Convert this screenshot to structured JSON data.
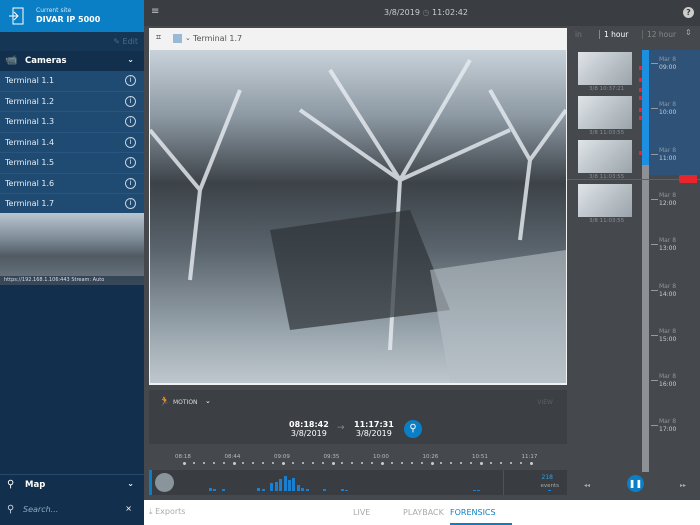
{
  "site": {
    "label": "Current site",
    "name": "DIVAR IP 5000",
    "edit": "Edit"
  },
  "cameras": {
    "title": "Cameras",
    "items": [
      "Terminal 1.1",
      "Terminal 1.2",
      "Terminal 1.3",
      "Terminal 1.4",
      "Terminal 1.5",
      "Terminal 1.6",
      "Terminal 1.7"
    ],
    "info_glyph": "i",
    "stream": "https://192.168.1.106:443 Stream: Auto"
  },
  "map": {
    "title": "Map"
  },
  "search": {
    "placeholder": "Search..."
  },
  "topbar": {
    "date": "3/8/2019",
    "time": "11:02:42"
  },
  "video": {
    "camera": "Terminal 1.7"
  },
  "motion": {
    "label": "MOTION",
    "view": "VIEW",
    "start_time": "08:18:42",
    "start_date": "3/8/2019",
    "end_time": "11:17:31",
    "end_date": "3/8/2019",
    "arrow": "→"
  },
  "timeline": {
    "ticks": [
      "08:18",
      "08:44",
      "09:09",
      "09:35",
      "10:00",
      "10:26",
      "10:51",
      "11:17"
    ],
    "events_count": "218",
    "events_label": "events",
    "bars": [
      0,
      0,
      3,
      2,
      0,
      2,
      0,
      0,
      0,
      0,
      0,
      0,
      0,
      3,
      2,
      0,
      8,
      9,
      12,
      15,
      11,
      13,
      6,
      3,
      2,
      0,
      0,
      0,
      2,
      0,
      0,
      0,
      2,
      1,
      0,
      0,
      0,
      0,
      0,
      0,
      0,
      0,
      0,
      0,
      0,
      0,
      0,
      0,
      0,
      0,
      0,
      0,
      0,
      0,
      0,
      0,
      0,
      0,
      0,
      0,
      0,
      0,
      1,
      1,
      0,
      0,
      0,
      0,
      0,
      0,
      0,
      0,
      0,
      0,
      0,
      0,
      0,
      0,
      0,
      1
    ]
  },
  "tabs": {
    "exports": "Exports",
    "live": "LIVE",
    "playback": "PLAYBACK",
    "forensics": "FORENSICS"
  },
  "right": {
    "zoom_options": [
      "in",
      "1 hour",
      "12 hour"
    ],
    "thumbs": [
      {
        "ts": "3/8 10:37:21"
      },
      {
        "ts": "3/8 11:03:55"
      },
      {
        "ts": "3/8 11:03:55"
      },
      {
        "ts": "3/8 11:03:55"
      }
    ],
    "times": [
      {
        "d": "Mar 8",
        "t": "09:00"
      },
      {
        "d": "Mar 8",
        "t": "10:00"
      },
      {
        "d": "Mar 8",
        "t": "11:00"
      },
      {
        "d": "Mar 8",
        "t": "12:00"
      },
      {
        "d": "Mar 8",
        "t": "13:00"
      },
      {
        "d": "Mar 8",
        "t": "14:00"
      },
      {
        "d": "Mar 8",
        "t": "15:00"
      },
      {
        "d": "Mar 8",
        "t": "16:00"
      },
      {
        "d": "Mar 8",
        "t": "17:00"
      }
    ]
  },
  "colors": {
    "accent": "#0b7fc6",
    "sidebar": "#12304e",
    "marker": "#e8242c"
  }
}
